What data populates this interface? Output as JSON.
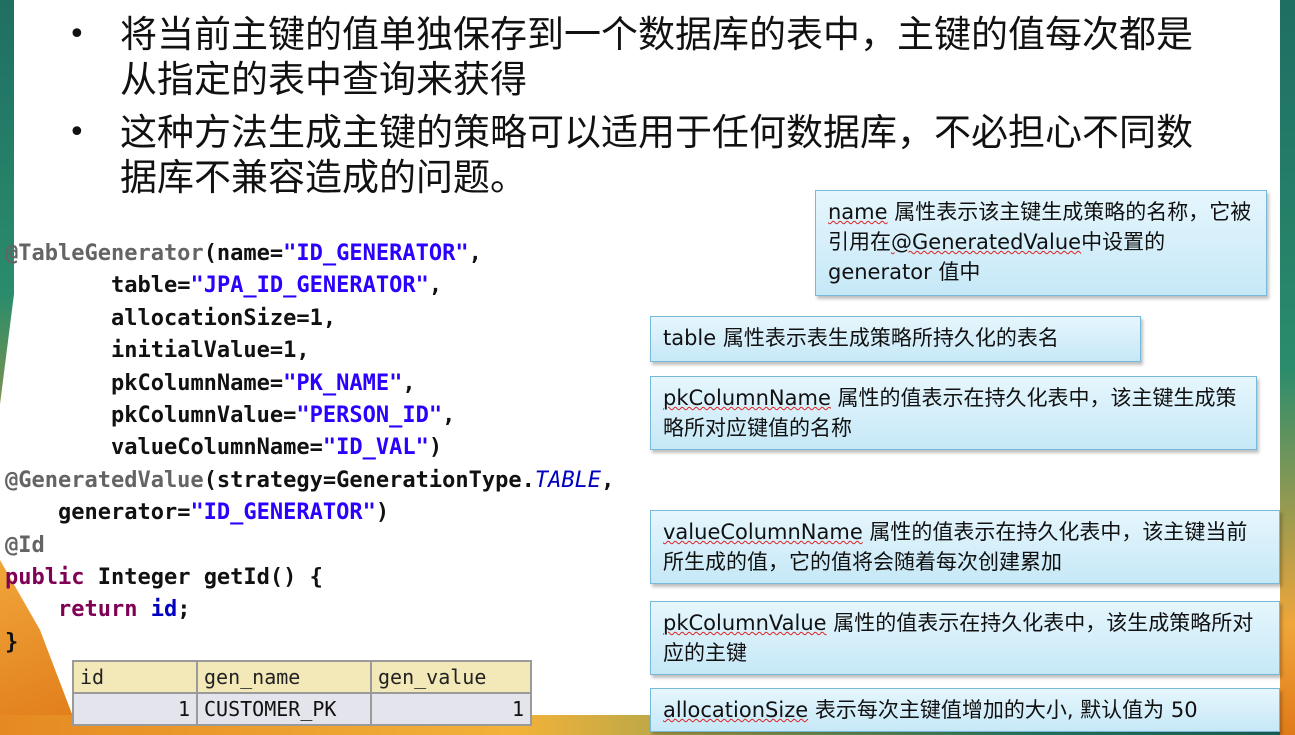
{
  "bullets": [
    {
      "marker": "•",
      "text": "将当前主键的值单独保存到一个数据库的表中，主键的值每次都是从指定的表中查询来获得"
    },
    {
      "marker": "•",
      "text": "这种方法生成主键的策略可以适用于任何数据库，不必担心不同数据库不兼容造成的问题。"
    }
  ],
  "code": {
    "l1_ann": "@TableGenerator",
    "l1_a": "(name=",
    "l1_s": "\"ID_GENERATOR\"",
    "l1_b": ",",
    "l2_a": "table=",
    "l2_s": "\"JPA_ID_GENERATOR\"",
    "l2_b": ",",
    "l3": "allocationSize=1,",
    "l4": "initialValue=1,",
    "l5_a": "pkColumnName=",
    "l5_s": "\"PK_NAME\"",
    "l5_b": ",",
    "l6_a": "pkColumnValue=",
    "l6_s": "\"PERSON_ID\"",
    "l6_b": ",",
    "l7_a": "valueColumnName=",
    "l7_s": "\"ID_VAL\"",
    "l7_b": ")",
    "l8_ann": "@GeneratedValue",
    "l8_a": "(strategy=GenerationType.",
    "l8_it": "TABLE",
    "l8_b": ",",
    "l9_a": "generator=",
    "l9_s": "\"ID_GENERATOR\"",
    "l9_b": ")",
    "l10_ann": "@Id",
    "l11_kw": "public",
    "l11_a": " Integer getId() {",
    "l12_kw": "return",
    "l12_fld": "id",
    "l12_b": ";",
    "l13": "}"
  },
  "db_table": {
    "headers": [
      "id",
      "gen_name",
      "gen_value"
    ],
    "row": [
      "1",
      "CUSTOMER_PK",
      "1"
    ]
  },
  "callouts": {
    "name": {
      "term": "name",
      "text": " 属性表示该主键生成策略的名称，它被引用在",
      "term2": "@GeneratedValue",
      "text2": "中设置的generator 值中"
    },
    "table": {
      "term": "table",
      "text": " 属性表示表生成策略所持久化的表名"
    },
    "pkColumnName": {
      "term": "pkColumnName",
      "text": " 属性的值表示在持久化表中，该主键生成策略所对应键值的名称"
    },
    "valueColumnName": {
      "term": "valueColumnName",
      "text": " 属性的值表示在持久化表中，该主键当前所生成的值，它的值将会随着每次创建累加"
    },
    "pkColumnValue": {
      "term": "pkColumnValue",
      "text": " 属性的值表示在持久化表中，该生成策略所对应的主键"
    },
    "allocationSize": {
      "term": "allocationSize",
      "text": " 表示每次主键值增加的大小, 默认值为 50"
    }
  }
}
